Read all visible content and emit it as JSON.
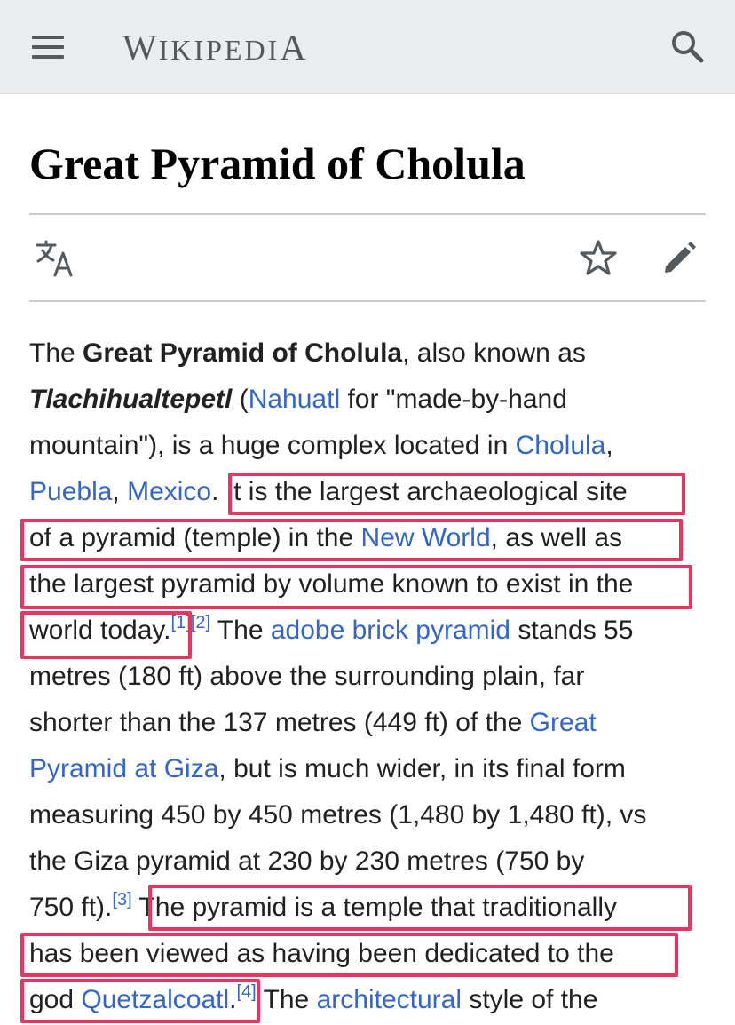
{
  "header": {
    "logo": {
      "first": "W",
      "middle": "IKIPEDI",
      "last": "A"
    },
    "menu_icon": "hamburger-menu-icon",
    "search_icon": "search-icon"
  },
  "article": {
    "title": "Great Pyramid of Cholula",
    "toolbar": {
      "language_icon": "translate-icon",
      "watch_icon": "star-icon",
      "edit_icon": "pencil-icon"
    }
  },
  "body": {
    "l1": {
      "a": "The ",
      "b": "Great Pyramid of Cholula",
      "c": ", also known as"
    },
    "l2": {
      "a": "Tlachihualtepetl",
      "b": " (",
      "c": "Nahuatl",
      "d": " for \"made-by-hand"
    },
    "l3": {
      "a": "mountain\"), is a huge complex located in ",
      "b": "Cholula",
      "c": ","
    },
    "l4": {
      "a": "Puebla",
      "b": ", ",
      "c": "Mexico",
      "d": ". It is the largest archaeological site"
    },
    "l5": {
      "a": "of a pyramid (temple) in the ",
      "b": "New World",
      "c": ", as well as"
    },
    "l6": {
      "a": "the largest pyramid by volume known to exist in the"
    },
    "l7": {
      "a": "world today.",
      "b": "[1][2]",
      "c": " The ",
      "d": "adobe brick pyramid",
      "e": " stands 55"
    },
    "l8": {
      "a": "metres (180 ft) above the surrounding plain, far"
    },
    "l9": {
      "a": "shorter than the 137 metres (449 ft) of the ",
      "b": "Great"
    },
    "l10": {
      "a": "Pyramid at Giza",
      "b": ", but is much wider, in its final form"
    },
    "l11": {
      "a": "measuring 450 by 450 metres (1,480 by 1,480 ft), vs"
    },
    "l12": {
      "a": "the Giza pyramid at 230 by 230 metres (750 by"
    },
    "l13": {
      "a": "750 ft).",
      "b": "[3]",
      "c": " The pyramid is a temple that traditionally"
    },
    "l14": {
      "a": "has been viewed as having been dedicated to the"
    },
    "l15": {
      "a": "god ",
      "b": "Quetzalcoatl",
      "c": ".",
      "d": "[4]",
      "e": " The ",
      "f": "architectural",
      "g": " style of the"
    }
  },
  "colors": {
    "link": "#3366cc",
    "highlight": "#e8345f",
    "header_bg": "#eaecf0"
  }
}
